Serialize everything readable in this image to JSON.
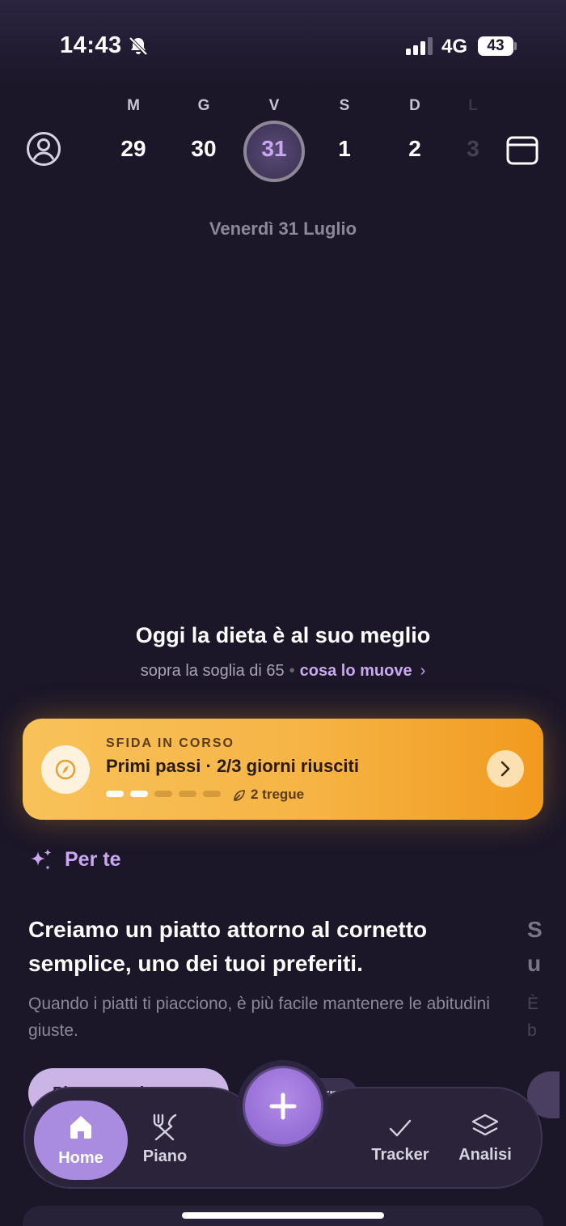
{
  "status_bar": {
    "time": "14:43",
    "network": "4G",
    "battery": "43"
  },
  "week": {
    "days": [
      {
        "dow": "M",
        "num": "29"
      },
      {
        "dow": "G",
        "num": "30"
      },
      {
        "dow": "V",
        "num": "31",
        "selected": true
      },
      {
        "dow": "S",
        "num": "1"
      },
      {
        "dow": "D",
        "num": "2"
      },
      {
        "dow": "L",
        "num": "3"
      }
    ],
    "date_label": "Venerdì 31 Luglio"
  },
  "summary": {
    "headline": "Oggi la dieta è al suo meglio",
    "subline": "sopra la soglia di 65",
    "link": "cosa lo muove"
  },
  "challenge": {
    "eyebrow": "SFIDA IN CORSO",
    "title": "Primi passi · 2/3 giorni riusciti",
    "progress": {
      "done": 2,
      "total": 5
    },
    "truces": "2 tregue"
  },
  "for_you": {
    "title": "Per te",
    "card": {
      "title": "Creiamo un piatto attorno al cornetto semplice, uno dei tuoi preferiti.",
      "description": "Quando i piatti ti piacciono, è più facile mantenere le abitudini giuste.",
      "button": "Piatto su misura",
      "chip": "rno"
    },
    "next_card": {
      "title": "S u",
      "description": "È b"
    }
  },
  "nav": {
    "home": "Home",
    "piano": "Piano",
    "tracker": "Tracker",
    "analisi": "Analisi"
  },
  "colors": {
    "background": "#1b1628",
    "accent": "#c9a8f0",
    "challenge": "#f6b445"
  }
}
